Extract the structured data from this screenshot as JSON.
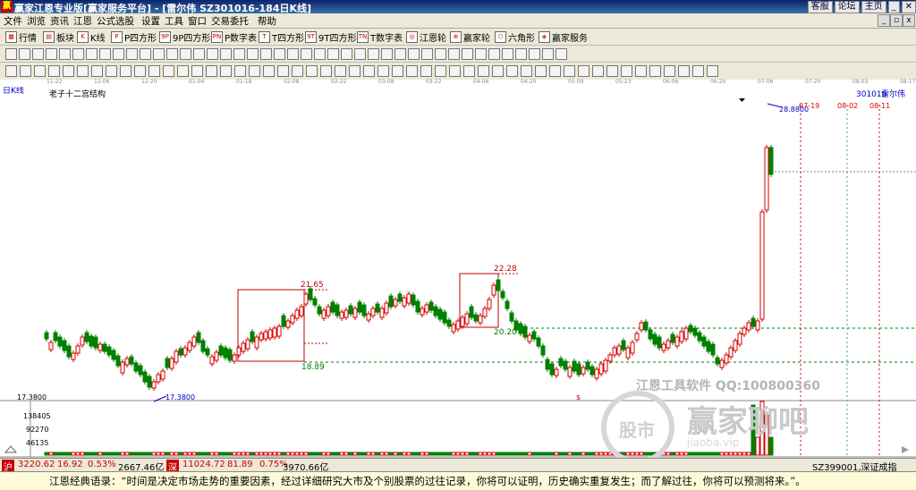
{
  "window": {
    "title": "赢家江恩专业版[赢家服务平台] - [雷尔伟  SZ301016-184日K线]",
    "links": [
      "客服",
      "论坛",
      "主页"
    ]
  },
  "menu": [
    "文件",
    "浏览",
    "资讯",
    "江恩",
    "公式选股",
    "设置",
    "工具",
    "窗口",
    "交易委托",
    "帮助"
  ],
  "toolbar1": [
    "行情",
    "板块",
    "K线",
    "P四方形",
    "9P四方形",
    "P数字表",
    "T四方形",
    "9T四方形",
    "T数字表",
    "江恩轮",
    "赢家轮",
    "六角形",
    "赢家服务"
  ],
  "date_axis": [
    "11-22",
    "12-06",
    "12-20",
    "01-04",
    "01-18",
    "02-08",
    "02-22",
    "03-08",
    "03-22",
    "04-06",
    "04-20",
    "05-09",
    "05-23",
    "06-06",
    "06-20",
    "07-06",
    "07-20",
    "08-03",
    "08-17"
  ],
  "chart": {
    "panel_label": "日K线",
    "study_label": "老子十二宫结构",
    "stock_code": "301016",
    "stock_name": "雷尔伟",
    "y_label_low": "17.3800",
    "volume_labels": [
      "138405",
      "92270",
      "46135"
    ],
    "annotations": {
      "high_low_1": "21.65",
      "high_low_2": "18.89",
      "high_low_3": "22.28",
      "high_low_4": "20.20",
      "low_mark": "17.3800",
      "high_mark": "28.8800",
      "date_a": "07-19",
      "date_b": "08-02",
      "date_c": "08-11"
    },
    "colors": {
      "up": "#d40000",
      "down": "#008000",
      "guide_green": "#008000",
      "box": "#c00000",
      "date_red": "#e00000",
      "date_teal": "#40a0a0"
    }
  },
  "chart_data": {
    "type": "candlestick",
    "title": "雷尔伟 SZ301016 日K线",
    "price_range": [
      17.38,
      28.88
    ],
    "annotated_levels": [
      17.38,
      18.89,
      20.2,
      21.65,
      22.28,
      28.88
    ],
    "volume_ticks": [
      46135,
      92270,
      138405
    ]
  },
  "watermark": {
    "line1": "江恩工具软件  QQ:100800360",
    "line2": "赢家聊吧",
    "line3": "jiaoba.vip",
    "seal": "股市"
  },
  "status": {
    "sh_index": "3220.62",
    "sh_change": "16.92",
    "sh_pct": "0.53%",
    "sh_amount": "2667.46亿",
    "sz_index": "11024.72",
    "sz_change": "81.89",
    "sz_pct": "0.75%",
    "sz_amount": "3970.66亿",
    "right_code": "SZ399001,深证成指"
  },
  "quote": {
    "text": "江恩经典语录：“时间是决定市场走势的重要因素，经过详细研究大市及个别股票的过往记录，你将可以证明，历史确实重复发生；而了解过往，你将可以预测将来。”。"
  }
}
